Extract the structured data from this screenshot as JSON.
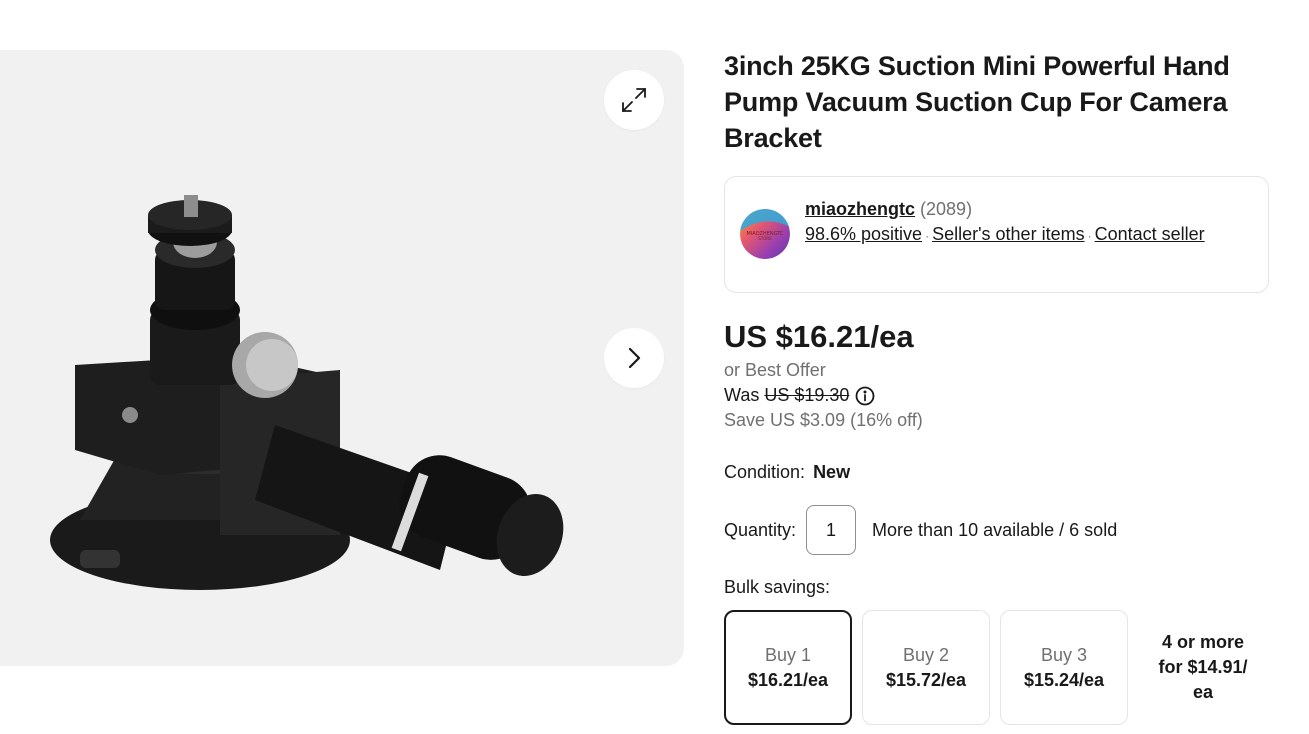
{
  "gallery": {
    "expand_icon": "expand-arrows-icon",
    "next_icon": "chevron-right-icon",
    "photo_alt": "suction cup mount product photo"
  },
  "product": {
    "title": "3inch 25KG Suction Mini Powerful Hand Pump Vacuum Suction Cup For Camera Bracket"
  },
  "seller": {
    "logo_text": "MIAOZHENGTC STORE",
    "name": "miaozhengtc",
    "feedback_count": "(2089)",
    "positive": "98.6% positive",
    "other_items": "Seller's other items",
    "contact": "Contact seller"
  },
  "pricing": {
    "price": "US $16.21/ea",
    "best_offer": "or Best Offer",
    "was_label": "Was",
    "was_price": "US $19.30",
    "save": "Save US $3.09 (16% off)"
  },
  "condition": {
    "label": "Condition:",
    "value": "New"
  },
  "quantity": {
    "label": "Quantity:",
    "value": "1",
    "availability": "More than 10 available / 6 sold"
  },
  "bulk": {
    "label": "Bulk savings:",
    "options": [
      {
        "qty": "Buy 1",
        "price": "$16.21/ea"
      },
      {
        "qty": "Buy 2",
        "price": "$15.72/ea"
      },
      {
        "qty": "Buy 3",
        "price": "$15.24/ea"
      }
    ],
    "more": "4 or more for $14.91/ ea"
  },
  "colors": {
    "text": "#191919",
    "muted": "#707070",
    "gallery_bg": "#f1f1f1",
    "border": "#e5e5e5"
  }
}
